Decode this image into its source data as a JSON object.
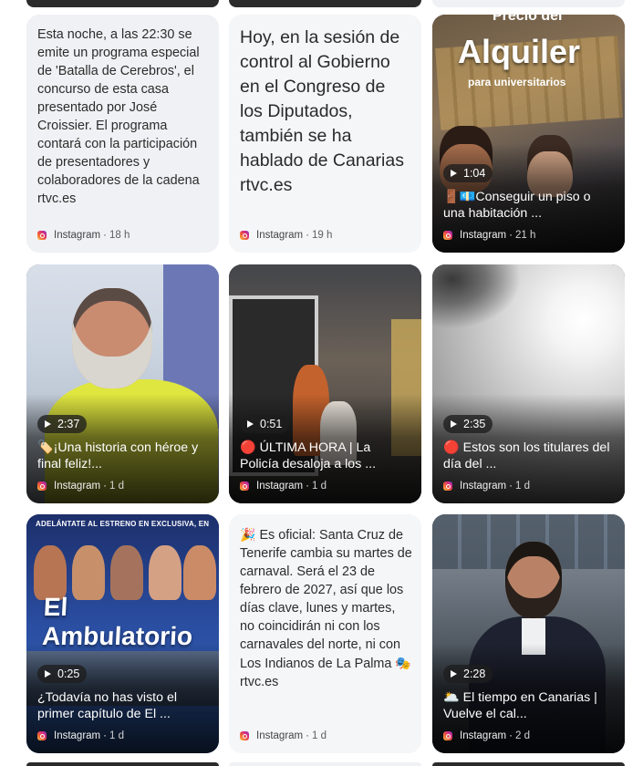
{
  "feed": {
    "cards": [
      {
        "id": "batalla",
        "kind": "text",
        "text": "Esta noche, a las 22:30 se emite un programa especial de 'Batalla de Cerebros', el concurso de esta casa presentado por José Croissier. El programa contará con la participación de presentadores y colaboradores de la cadena rtvc.es",
        "source": "Instagram",
        "time": "18 h"
      },
      {
        "id": "gobierno",
        "kind": "text",
        "text": "Hoy, en la sesión de control al Gobierno en el Congreso de los Diputados, también se ha hablado de Canarias rtvc.es",
        "source": "Instagram",
        "time": "19 h"
      },
      {
        "id": "alquiler",
        "kind": "video",
        "thumb_top": "Precio del",
        "thumb_word": "Alquiler",
        "thumb_sub": "para universitarios",
        "duration": "1:04",
        "caption": "🚪💶Conseguir un piso o una habitación ...",
        "source": "Instagram",
        "time": "21 h"
      },
      {
        "id": "historia",
        "kind": "video",
        "duration": "2:37",
        "caption": "🏷️¡Una historia con héroe y final feliz!...",
        "source": "Instagram",
        "time": "1 d"
      },
      {
        "id": "ultima-hora",
        "kind": "video",
        "duration": "0:51",
        "caption": "🔴 ÚLTIMA HORA | La Policía desaloja a los ...",
        "source": "Instagram",
        "time": "1 d"
      },
      {
        "id": "titulares",
        "kind": "video",
        "duration": "2:35",
        "caption": "🔴 Estos son los titulares del día del ...",
        "source": "Instagram",
        "time": "1 d"
      },
      {
        "id": "ambulatorio",
        "kind": "video",
        "thumb_banner": "ADELÁNTATE AL ESTRENO EN EXCLUSIVA, EN",
        "thumb_title": "El Ambulatorio",
        "duration": "0:25",
        "caption": "¿Todavía no has visto el primer capítulo de El ...",
        "source": "Instagram",
        "time": "1 d"
      },
      {
        "id": "carnaval",
        "kind": "text",
        "text_prefix": "🎉",
        "text": "Es oficial: Santa Cruz de Tenerife cambia su martes de carnaval. Será el 23 de febrero de 2027, así que los días clave, lunes y martes, no coincidirán ni con los carnavales del norte, ni con Los Indianos de La Palma",
        "text_suffix_icon": "🎭",
        "text_suffix": "rtvc.es",
        "source": "Instagram",
        "time": "1 d"
      },
      {
        "id": "tiempo",
        "kind": "video",
        "duration": "2:28",
        "caption": "🌥️ El tiempo en Canarias | Vuelve el cal...",
        "source": "Instagram",
        "time": "2 d"
      }
    ],
    "separator": "·"
  },
  "colors": {
    "text_card_bg": "#f0f1f4",
    "instagram_gradient": [
      "#f9c846",
      "#f05a38",
      "#d52d81",
      "#8138c9"
    ],
    "duration_pill": "#1e1e1e"
  },
  "icons": {
    "source": "instagram-icon",
    "duration": "play-icon"
  }
}
